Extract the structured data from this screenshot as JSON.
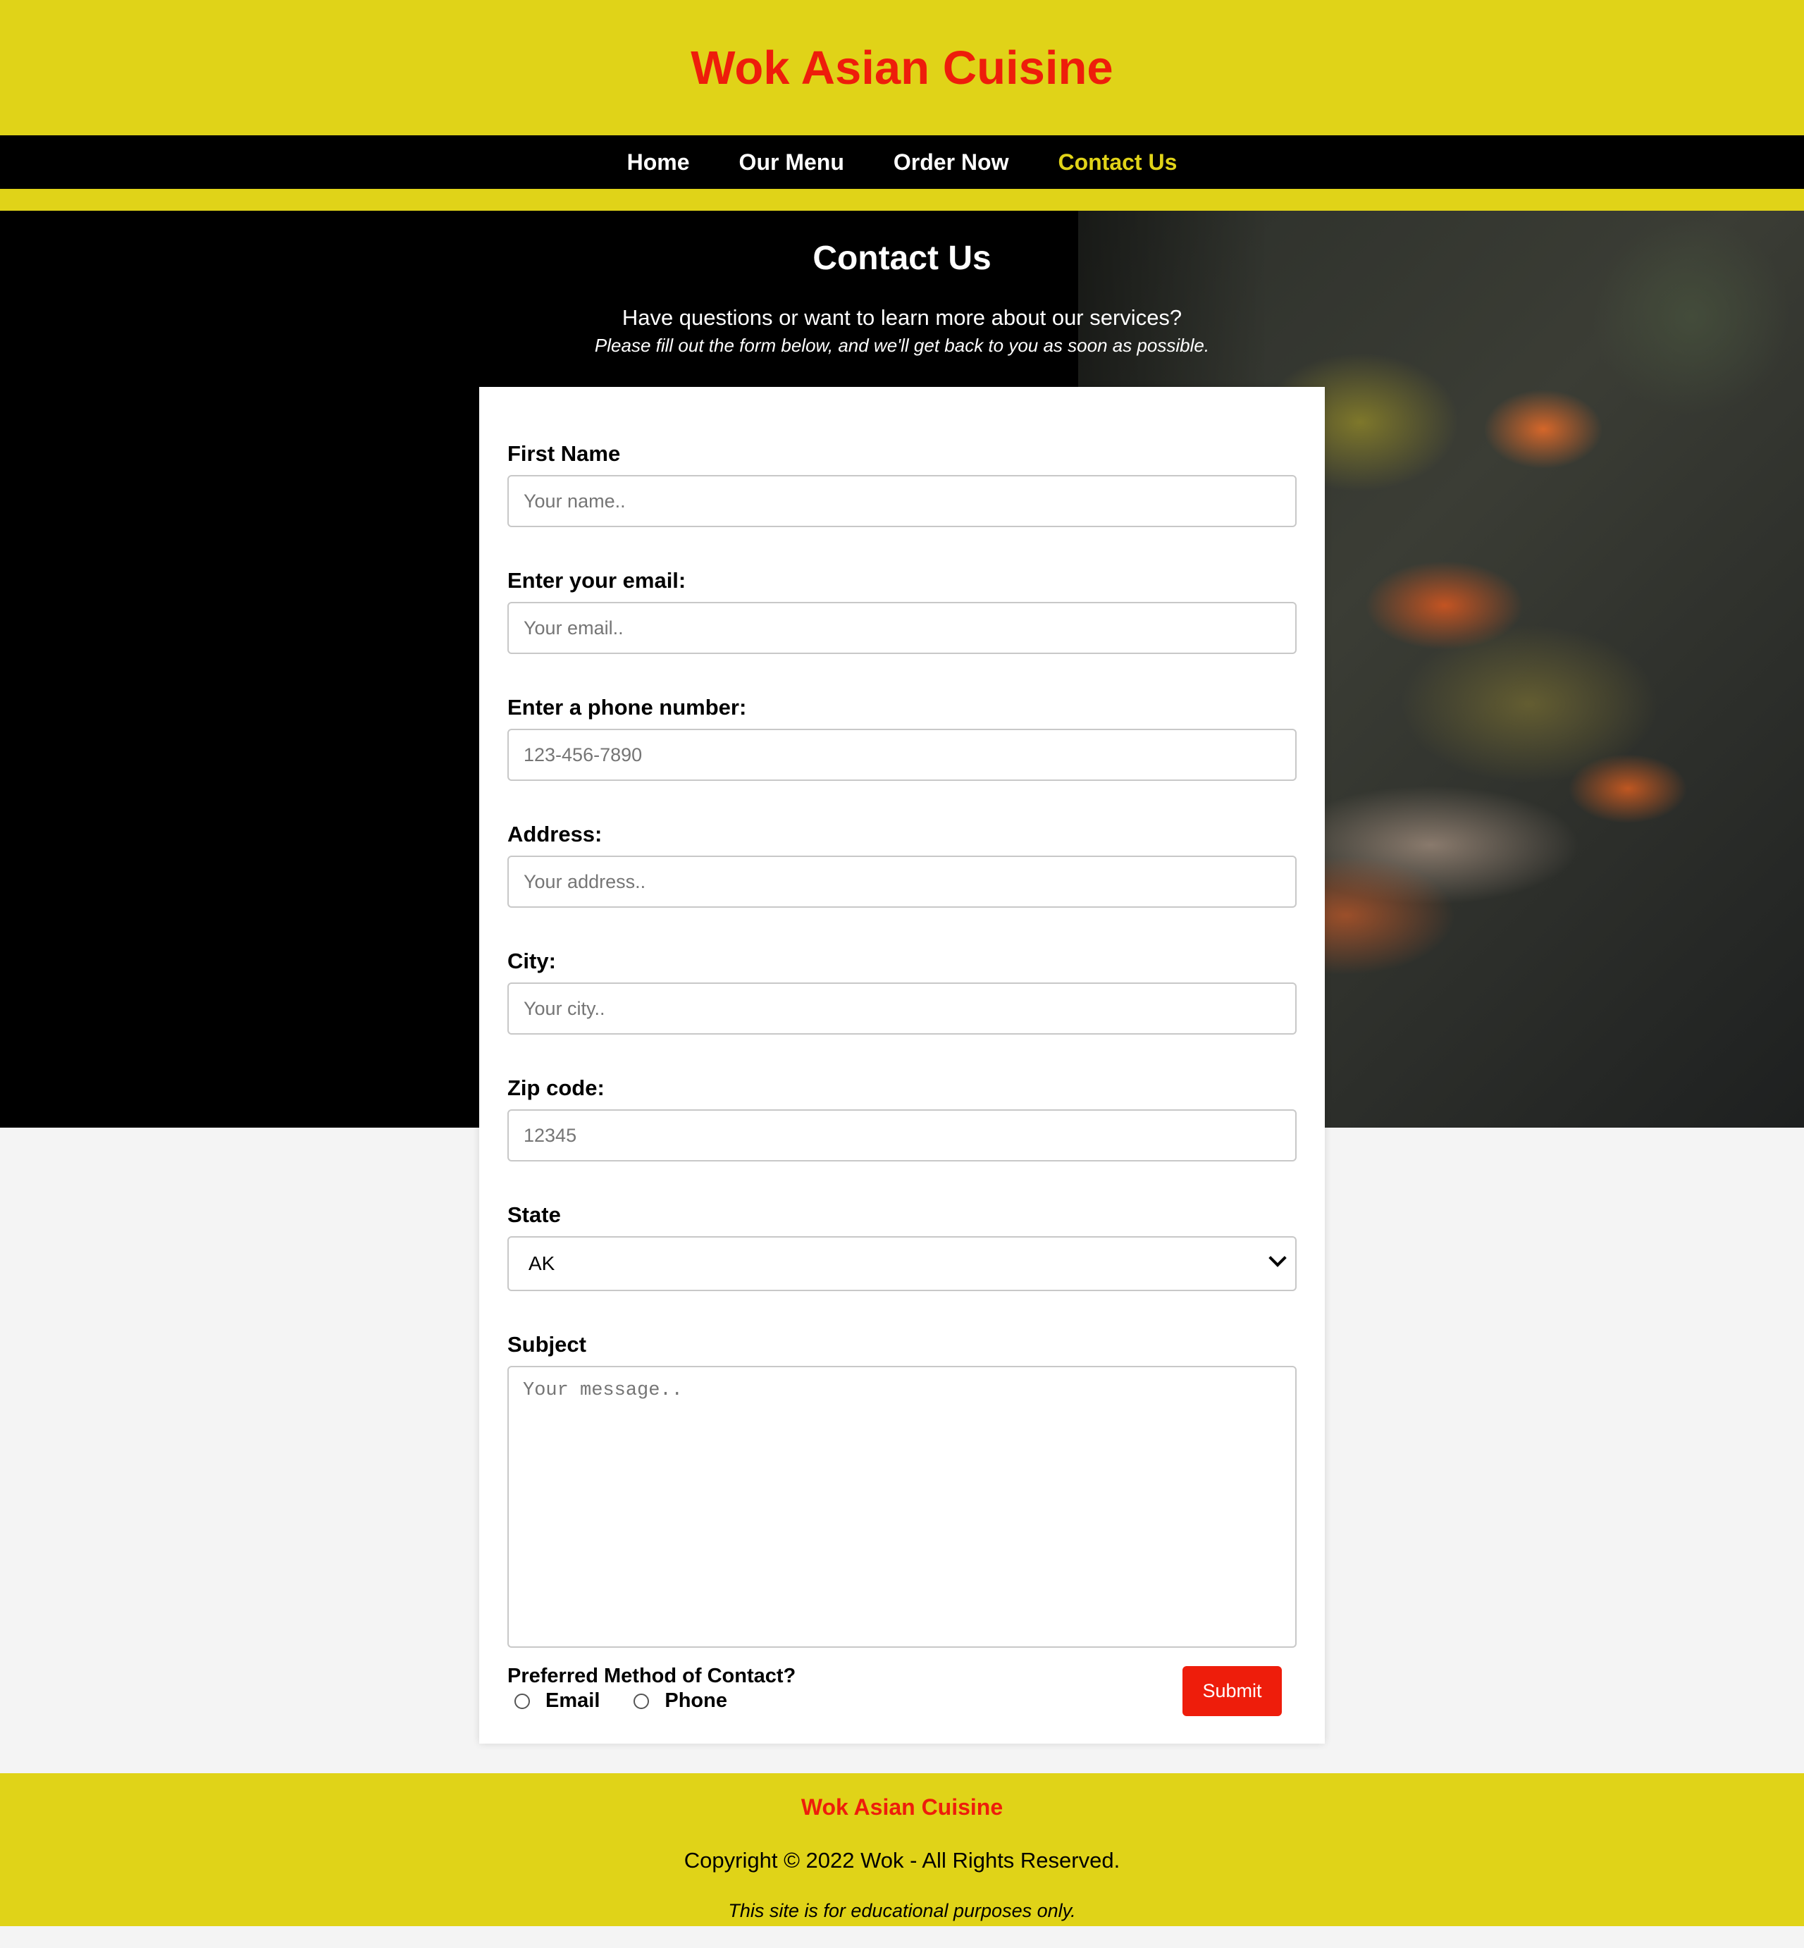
{
  "header": {
    "title": "Wok Asian Cuisine"
  },
  "nav": {
    "items": [
      {
        "label": "Home"
      },
      {
        "label": "Our Menu"
      },
      {
        "label": "Order Now"
      },
      {
        "label": "Contact Us",
        "active": true
      }
    ]
  },
  "hero": {
    "title": "Contact Us",
    "subtitle": "Have questions or want to learn more about our services?",
    "note": "Please fill out the form below, and we'll get back to you as soon as possible."
  },
  "form": {
    "first_name": {
      "label": "First Name",
      "placeholder": "Your name..",
      "value": ""
    },
    "email": {
      "label": "Enter your email:",
      "placeholder": "Your email..",
      "value": ""
    },
    "phone": {
      "label": "Enter a phone number:",
      "placeholder": "123-456-7890",
      "value": ""
    },
    "address": {
      "label": "Address:",
      "placeholder": "Your address..",
      "value": ""
    },
    "city": {
      "label": "City:",
      "placeholder": "Your city..",
      "value": ""
    },
    "zip": {
      "label": "Zip code:",
      "placeholder": "12345",
      "value": ""
    },
    "state": {
      "label": "State",
      "selected": "AK"
    },
    "subject": {
      "label": "Subject",
      "placeholder": "Your message..",
      "value": ""
    },
    "contact_method": {
      "question": "Preferred Method of Contact?",
      "options": [
        {
          "label": "Email"
        },
        {
          "label": "Phone"
        }
      ]
    },
    "submit_label": "Submit"
  },
  "footer": {
    "title": "Wok Asian Cuisine",
    "copyright": "Copyright © 2022 Wok - All Rights Reserved.",
    "note": "This site is for educational purposes only."
  },
  "colors": {
    "brand_yellow": "#e0d318",
    "brand_red": "#ee1d0b",
    "nav_bg": "#000000",
    "page_bg": "#f4f4f4"
  }
}
